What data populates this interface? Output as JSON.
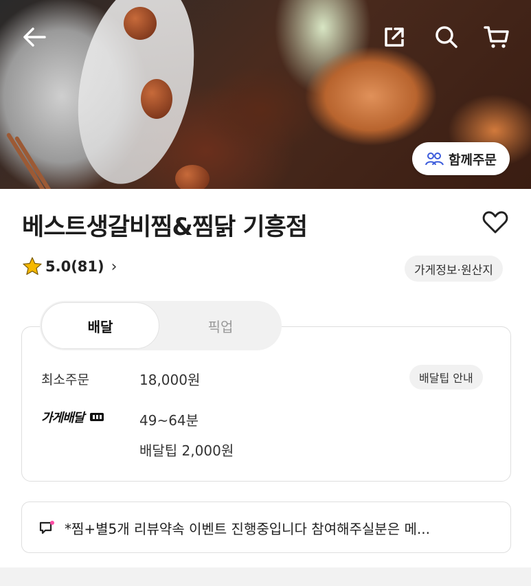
{
  "header": {
    "back_icon": "arrow-left-icon",
    "share_icon": "share-external-icon",
    "search_icon": "search-icon",
    "cart_icon": "cart-icon",
    "together_order": {
      "icon": "people-icon",
      "label": "함께주문"
    }
  },
  "store": {
    "name": "베스트생갈비찜&찜닭 기흥점",
    "favorite_icon": "heart-outline-icon",
    "rating": {
      "icon": "star-icon",
      "text": "5.0(81)",
      "chevron": "›"
    },
    "info_chip": "가게정보·원산지"
  },
  "order_tabs": [
    {
      "label": "배달",
      "active": true
    },
    {
      "label": "픽업",
      "active": false
    }
  ],
  "delivery": {
    "min_order_label": "최소주문",
    "min_order_value": "18,000원",
    "tip_guide_chip": "배달팁 안내",
    "brand_label": "가게배달",
    "time": "49~64분",
    "tip": "배달팁 2,000원"
  },
  "notice": {
    "icon": "megaphone-icon",
    "text": "*찜+별5개 리뷰약속 이벤트 진행중입니다 참여해주실분은 메..."
  },
  "colors": {
    "accent_star": "#f5b800",
    "text_primary": "#222222",
    "chip_bg": "#f1f1f1",
    "people_icon": "#3b5bdb"
  }
}
